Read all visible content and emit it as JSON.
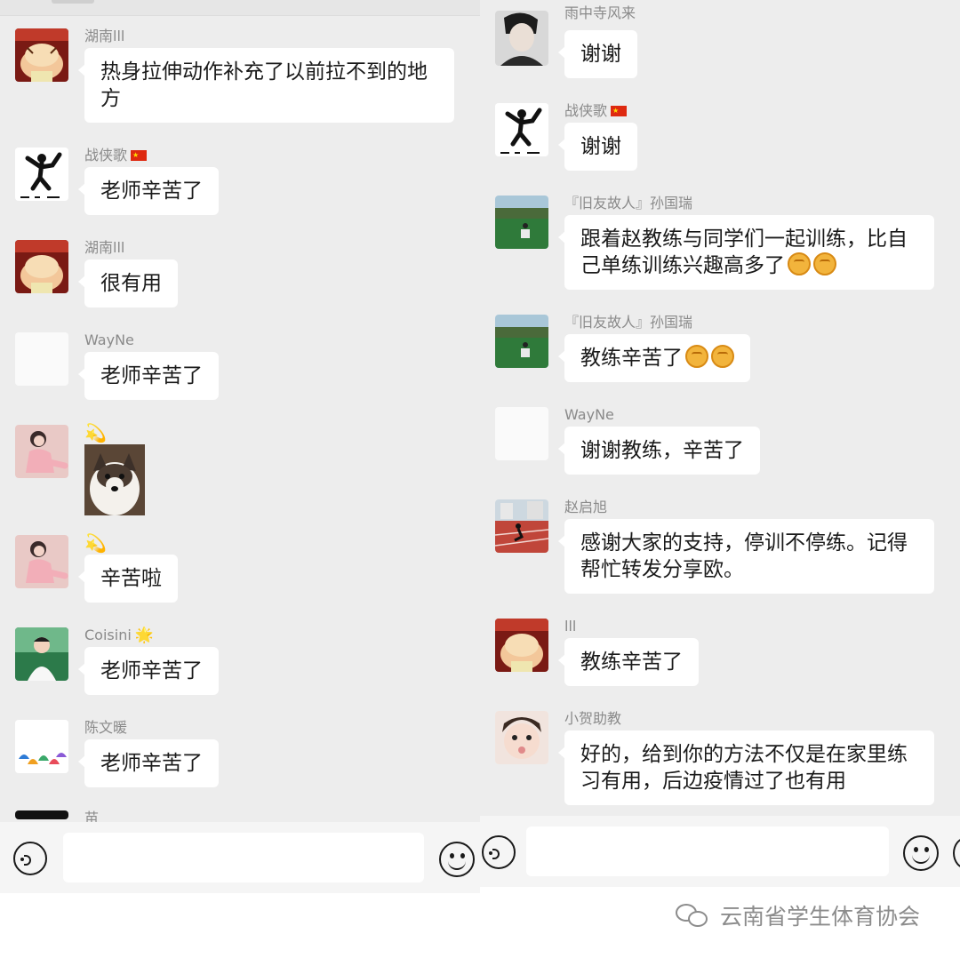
{
  "left": {
    "messages": [
      {
        "sender": "湖南lll",
        "text": "热身拉伸动作补充了以前拉不到的地方",
        "avatar": "cartoon-avatar"
      },
      {
        "sender": "战侠歌",
        "badge": "flag",
        "text": "老师辛苦了",
        "avatar": "sprinter-avatar"
      },
      {
        "sender": "湖南lll",
        "text": "很有用",
        "avatar": "cartoon-avatar"
      },
      {
        "sender": "WayNe",
        "text": "老师辛苦了",
        "avatar": "blank-avatar"
      },
      {
        "sender": "",
        "badge": "swirl",
        "image": "puppy-sticker",
        "avatar": "girl-avatar"
      },
      {
        "sender": "",
        "badge": "swirl",
        "text": "辛苦啦",
        "avatar": "girl-avatar"
      },
      {
        "sender": "Coisini",
        "badge": "star",
        "text": "老师辛苦了",
        "avatar": "boy-avatar"
      },
      {
        "sender": "陈文暖",
        "text": "老师辛苦了",
        "avatar": "colorful-avatar"
      },
      {
        "sender": "苗",
        "avatar": "dark-avatar"
      }
    ]
  },
  "right": {
    "messages": [
      {
        "sender": "雨中寺风来",
        "text": "谢谢",
        "avatar": "man-avatar"
      },
      {
        "sender": "战侠歌",
        "badge": "flag",
        "text": "谢谢",
        "avatar": "sprinter-avatar"
      },
      {
        "sender": "『旧友故人』孙国瑞",
        "text": "跟着赵教练与同学们一起训练，比自己单练训练兴趣高多了",
        "emoji_count": 2,
        "avatar": "field-avatar"
      },
      {
        "sender": "『旧友故人』孙国瑞",
        "text": "教练辛苦了",
        "emoji_count": 2,
        "avatar": "field-avatar"
      },
      {
        "sender": "WayNe",
        "text": "谢谢教练，辛苦了",
        "avatar": "blank-avatar"
      },
      {
        "sender": "赵启旭",
        "text": "感谢大家的支持，停训不停练。记得帮忙转发分享欧。",
        "avatar": "track-avatar"
      },
      {
        "sender": "lll",
        "text": "教练辛苦了",
        "avatar": "cartoon-avatar"
      },
      {
        "sender": "小贺助教",
        "text": "好的，给到你的方法不仅是在家里练习有用，后边疫情过了也有用",
        "avatar": "baby-avatar"
      }
    ]
  },
  "watermark": "云南省学生体育协会",
  "icons": {
    "voice": "voice-icon",
    "emoji": "emoji-icon",
    "wechat": "wechat-icon"
  }
}
